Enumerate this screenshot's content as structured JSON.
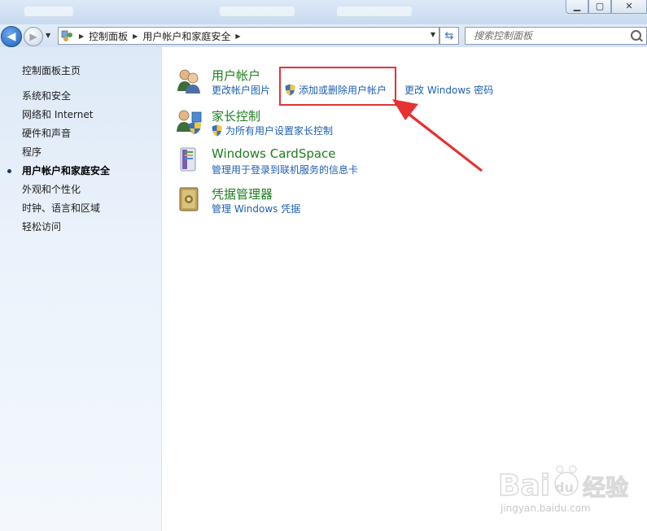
{
  "window": {
    "controls": [
      "minimize",
      "maximize",
      "close"
    ]
  },
  "navbar": {
    "breadcrumbs": [
      "控制面板",
      "用户帐户和家庭安全"
    ],
    "search_placeholder": "搜索控制面板"
  },
  "sidebar": {
    "home": "控制面板主页",
    "items": [
      {
        "label": "系统和安全",
        "active": false
      },
      {
        "label": "网络和 Internet",
        "active": false
      },
      {
        "label": "硬件和声音",
        "active": false
      },
      {
        "label": "程序",
        "active": false
      },
      {
        "label": "用户帐户和家庭安全",
        "active": true
      },
      {
        "label": "外观和个性化",
        "active": false
      },
      {
        "label": "时钟、语言和区域",
        "active": false
      },
      {
        "label": "轻松访问",
        "active": false
      }
    ]
  },
  "categories": [
    {
      "title": "用户帐户",
      "icon": "users-icon",
      "links": [
        {
          "label": "更改帐户图片",
          "shield": false
        },
        {
          "label": "添加或删除用户帐户",
          "shield": true
        },
        {
          "label": "更改 Windows 密码",
          "shield": false
        }
      ]
    },
    {
      "title": "家长控制",
      "icon": "parental-controls-icon",
      "links": [
        {
          "label": "为所有用户设置家长控制",
          "shield": true
        }
      ]
    },
    {
      "title": "Windows CardSpace",
      "icon": "cardspace-icon",
      "links": [
        {
          "label": "管理用于登录到联机服务的信息卡",
          "shield": false
        }
      ]
    },
    {
      "title": "凭据管理器",
      "icon": "credential-manager-icon",
      "links": [
        {
          "label": "管理 Windows 凭据",
          "shield": false
        }
      ]
    }
  ],
  "watermark": {
    "brand": "Baidu 经验",
    "url": "jingyan.baidu.com"
  },
  "colors": {
    "link": "#1c5fb4",
    "category_title": "#1f7d1f",
    "annotation": "#e63232"
  }
}
